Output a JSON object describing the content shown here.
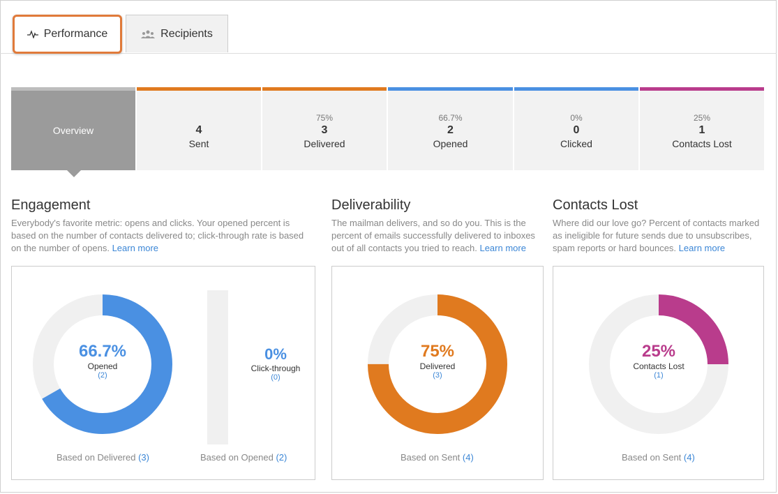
{
  "tabs": [
    {
      "label": "Performance",
      "icon": "pulse-icon",
      "active": true
    },
    {
      "label": "Recipients",
      "icon": "people-icon",
      "active": false
    }
  ],
  "stats": {
    "overview": {
      "label": "Overview"
    },
    "sent": {
      "pct": "",
      "num": "4",
      "label": "Sent",
      "color": "#e07a1f"
    },
    "delivered": {
      "pct": "75%",
      "num": "3",
      "label": "Delivered",
      "color": "#e07a1f"
    },
    "opened": {
      "pct": "66.7%",
      "num": "2",
      "label": "Opened",
      "color": "#4a90e2"
    },
    "clicked": {
      "pct": "0%",
      "num": "0",
      "label": "Clicked",
      "color": "#4a90e2"
    },
    "lost": {
      "pct": "25%",
      "num": "1",
      "label": "Contacts Lost",
      "color": "#b93c8c"
    }
  },
  "engagement": {
    "title": "Engagement",
    "desc": "Everybody's favorite metric: opens and clicks. Your opened percent is based on the number of contacts delivered to; click-through rate is based on the number of opens.",
    "learn_more": "Learn more",
    "donut": {
      "pct": "66.7%",
      "label": "Opened",
      "count": "(2)",
      "fraction": 0.667,
      "color": "#4a90e2"
    },
    "bar": {
      "pct": "0%",
      "label": "Click-through",
      "count": "(0)",
      "fraction": 0,
      "color": "#4a90e2"
    },
    "foot_left": {
      "text": "Based on Delivered",
      "n": "(3)"
    },
    "foot_right": {
      "text": "Based on Opened",
      "n": "(2)"
    }
  },
  "deliverability": {
    "title": "Deliverability",
    "desc": "The mailman delivers, and so do you. This is the percent of emails successfully delivered to inboxes out of all contacts you tried to reach.",
    "learn_more": "Learn more",
    "donut": {
      "pct": "75%",
      "label": "Delivered",
      "count": "(3)",
      "fraction": 0.75,
      "color": "#e07a1f"
    },
    "foot": {
      "text": "Based on Sent",
      "n": "(4)"
    }
  },
  "contacts_lost": {
    "title": "Contacts Lost",
    "desc": "Where did our love go? Percent of contacts marked as ineligible for future sends due to unsubscribes, spam reports or hard bounces.",
    "learn_more": "Learn more",
    "donut": {
      "pct": "25%",
      "label": "Contacts Lost",
      "count": "(1)",
      "fraction": 0.25,
      "color": "#b93c8c"
    },
    "foot": {
      "text": "Based on Sent",
      "n": "(4)"
    }
  },
  "colors": {
    "track": "#f0f0f0",
    "link": "#3b86d6",
    "tab_highlight": "#e07a3a"
  }
}
